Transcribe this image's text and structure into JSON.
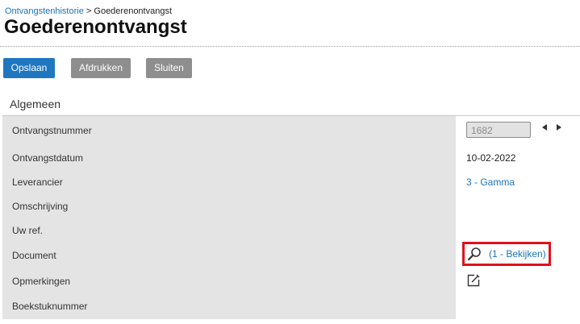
{
  "breadcrumb": {
    "parent": "Ontvangstenhistorie",
    "separator": " > ",
    "current": "Goederenontvangst"
  },
  "page": {
    "title": "Goederenontvangst"
  },
  "toolbar": {
    "save_label": "Opslaan",
    "print_label": "Afdrukken",
    "close_label": "Sluiten"
  },
  "section": {
    "title": "Algemeen"
  },
  "fields": {
    "receipt_number": {
      "label": "Ontvangstnummer",
      "value": "1682"
    },
    "receipt_date": {
      "label": "Ontvangstdatum",
      "value": "10-02-2022"
    },
    "supplier": {
      "label": "Leverancier",
      "value": "3 - Gamma"
    },
    "description": {
      "label": "Omschrijving",
      "value": ""
    },
    "your_ref": {
      "label": "Uw ref.",
      "value": ""
    },
    "document": {
      "label": "Document",
      "value": "(1 - Bekijken)",
      "icon": "magnifier-icon"
    },
    "remarks": {
      "label": "Opmerkingen",
      "icon": "edit-note-icon"
    },
    "entry_number": {
      "label": "Boekstuknummer",
      "value": ""
    }
  },
  "colors": {
    "accent": "#1f77c0",
    "link": "#1a73b8",
    "highlight": "#e0111b",
    "label_bg": "#e4e4e4"
  }
}
